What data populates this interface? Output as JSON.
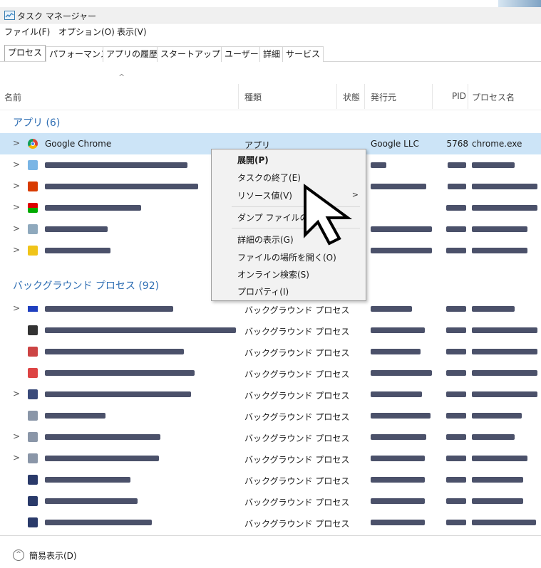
{
  "window": {
    "title": "タスク マネージャー"
  },
  "menu": [
    "ファイル(F)",
    "オプション(O)",
    "表示(V)"
  ],
  "tabs": [
    "プロセス",
    "パフォーマンス",
    "アプリの履歴",
    "スタートアップ",
    "ユーザー",
    "詳細",
    "サービス"
  ],
  "columns": {
    "name": "名前",
    "type": "種類",
    "status": "状態",
    "publisher": "発行元",
    "pid": "PID",
    "process_name": "プロセス名"
  },
  "groups": {
    "apps": "アプリ (6)",
    "background": "バックグラウンド プロセス (92)"
  },
  "selected_row": {
    "name": "Google Chrome",
    "type": "アプリ",
    "publisher": "Google LLC",
    "pid": "5768",
    "process_name": "chrome.exe"
  },
  "background_type_label": "バックグラウンド プロセス",
  "context_menu": [
    "展開(P)",
    "タスクの終了(E)",
    "リソース値(V)",
    "ダンプ ファイルの作成",
    "詳細の表示(G)",
    "ファイルの場所を開く(O)",
    "オンライン検索(S)",
    "プロパティ(I)"
  ],
  "footer": {
    "fewer_details": "簡易表示(D)"
  },
  "icons": {
    "app": "task-manager-icon",
    "chrome": "chrome-icon",
    "cursor": "arrow-cursor-icon",
    "collapse": "chevron-up-circle-icon"
  },
  "colors": {
    "group_heading": "#2d6db3",
    "selected_row": "#cce4f7",
    "context_menu_bg": "#f2f2f2"
  }
}
